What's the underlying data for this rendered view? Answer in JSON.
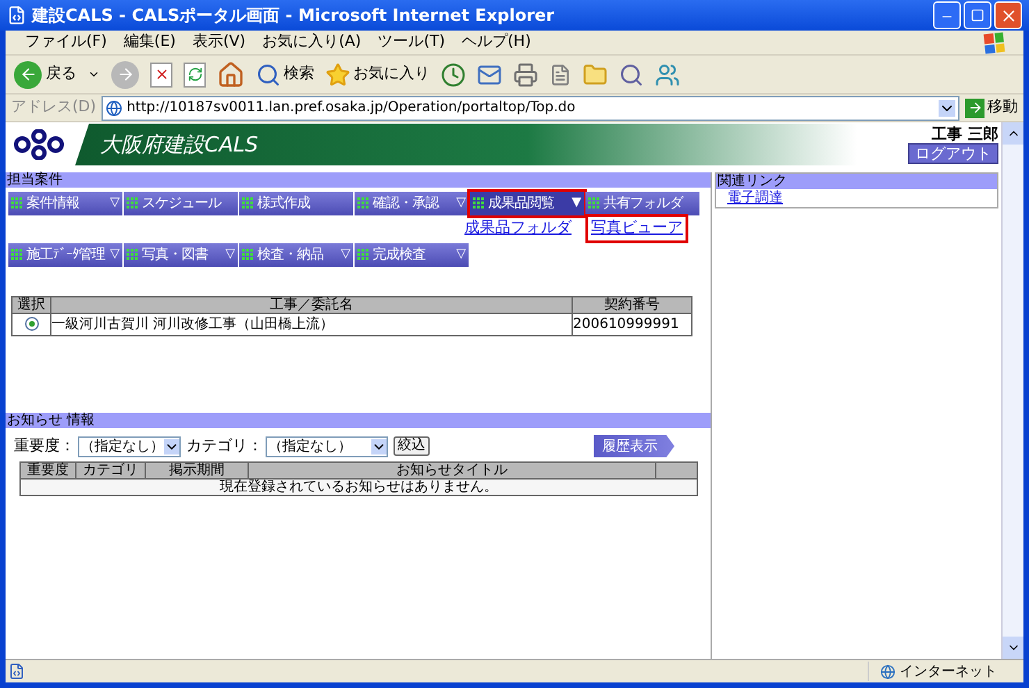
{
  "window": {
    "title": "建設CALS - CALSポータル画面 - Microsoft Internet Explorer"
  },
  "menu_bar": [
    "ファイル(F)",
    "編集(E)",
    "表示(V)",
    "お気に入り(A)",
    "ツール(T)",
    "ヘルプ(H)"
  ],
  "toolbar": {
    "back": "戻る",
    "search": "検索",
    "favorites": "お気に入り"
  },
  "address_bar": {
    "label": "アドレス(D)",
    "url": "http://10187sv0011.lan.pref.osaka.jp/Operation/portaltop/Top.do",
    "go": "移動"
  },
  "header": {
    "site_title": "大阪府建設CALS",
    "user": "工事 三郎",
    "logout": "ログアウト"
  },
  "projects": {
    "title": "担当案件",
    "menu_rows": [
      [
        {
          "label": "案件情報",
          "arrow": "▽",
          "selected": false
        },
        {
          "label": "スケジュール",
          "selected": false
        },
        {
          "label": "様式作成",
          "selected": false
        },
        {
          "label": "確認・承認",
          "arrow": "▽",
          "selected": false
        },
        {
          "label": "成果品閲覧",
          "arrow": "▼",
          "selected": true
        },
        {
          "label": "共有フォルダ",
          "selected": false
        }
      ],
      [
        {
          "label": "施工ﾃﾞｰﾀ管理",
          "arrow": "▽",
          "selected": false
        },
        {
          "label": "写真・図書",
          "arrow": "▽",
          "selected": false
        },
        {
          "label": "検査・納品",
          "arrow": "▽",
          "selected": false
        },
        {
          "label": "完成検査",
          "arrow": "▽",
          "selected": false
        }
      ]
    ],
    "submenu": [
      {
        "label": "成果品フォルダ",
        "highlighted": false
      },
      {
        "label": "写真ビューア",
        "highlighted": true
      }
    ],
    "table": {
      "columns": [
        "選択",
        "工事／委託名",
        "契約番号"
      ],
      "rows": [
        {
          "selected": true,
          "name": "一級河川古賀川 河川改修工事（山田橋上流）",
          "contract_no": "200610999991"
        }
      ]
    }
  },
  "notices": {
    "title": "お知らせ 情報",
    "filters": [
      {
        "label": "重要度：",
        "value": "（指定なし）"
      },
      {
        "label": "カテゴリ：",
        "value": "（指定なし）"
      }
    ],
    "filter_button": "絞込",
    "history_button": "履歴表示",
    "columns": [
      "重要度",
      "カテゴリ",
      "掲示期間",
      "お知らせタイトル"
    ],
    "empty_message": "現在登録されているお知らせはありません。"
  },
  "related_links": {
    "title": "関連リンク",
    "links": [
      "電子調達"
    ]
  },
  "status_bar": {
    "zone": "インターネット"
  }
}
